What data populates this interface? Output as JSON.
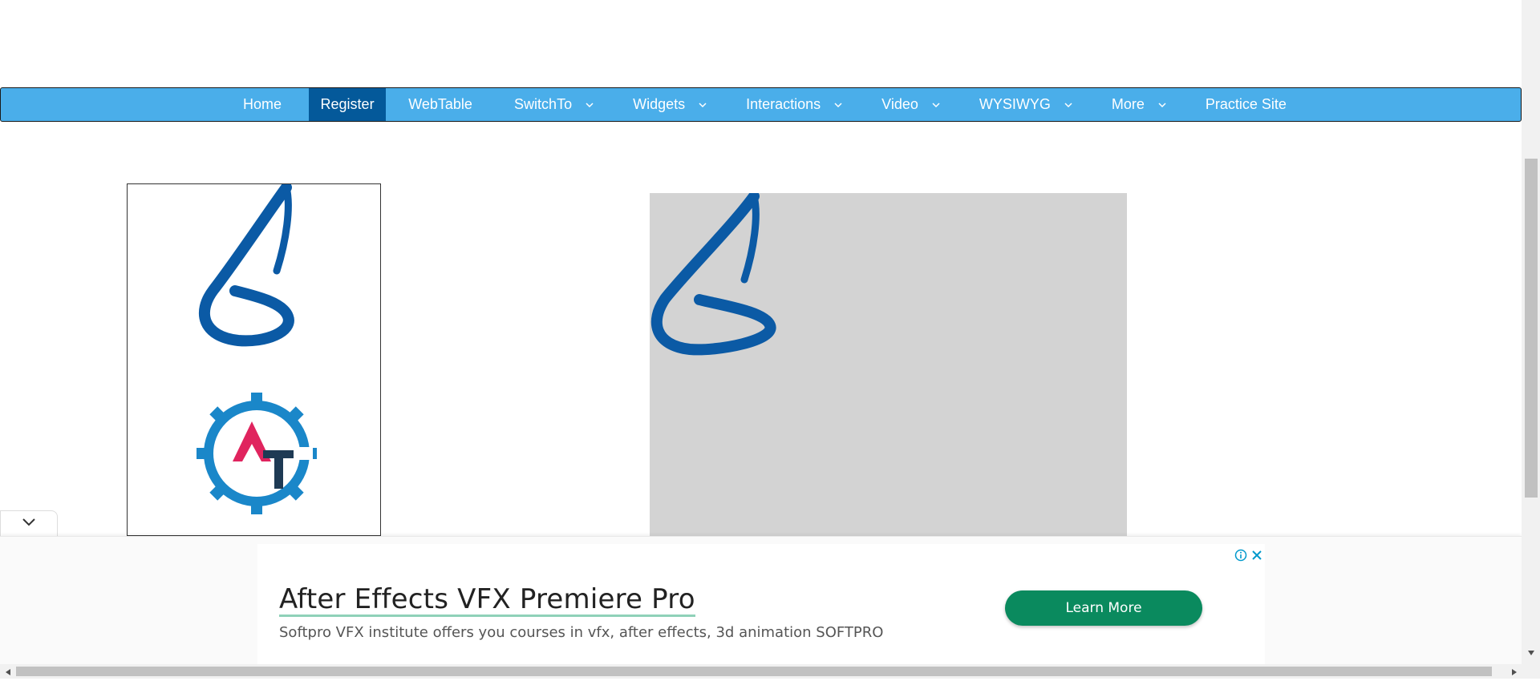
{
  "nav": {
    "items": [
      {
        "label": "Home",
        "dropdown": false,
        "active": false
      },
      {
        "label": "Register",
        "dropdown": false,
        "active": true
      },
      {
        "label": "WebTable",
        "dropdown": false,
        "active": false
      },
      {
        "label": "SwitchTo",
        "dropdown": true,
        "active": false
      },
      {
        "label": "Widgets",
        "dropdown": true,
        "active": false
      },
      {
        "label": "Interactions",
        "dropdown": true,
        "active": false
      },
      {
        "label": "Video",
        "dropdown": true,
        "active": false
      },
      {
        "label": "WYSIWYG",
        "dropdown": true,
        "active": false
      },
      {
        "label": "More",
        "dropdown": true,
        "active": false
      },
      {
        "label": "Practice Site",
        "dropdown": false,
        "active": false
      }
    ]
  },
  "drag_box": {
    "icons": [
      "selenium-s-logo",
      "automation-testing-gear-logo"
    ]
  },
  "drop_box": {
    "icons": [
      "selenium-s-logo"
    ]
  },
  "ad": {
    "title": "After Effects VFX Premiere Pro",
    "description": "Softpro VFX institute offers you courses in vfx, after effects, 3d animation SOFTPRO",
    "button_label": "Learn More",
    "icons": [
      "info-icon",
      "close-icon"
    ]
  },
  "colors": {
    "nav_bg": "#4aaeea",
    "nav_active": "#04599a",
    "drop_bg": "#d3d3d3",
    "logo_blue": "#0b5aa5",
    "logo_red": "#e0245e",
    "ad_button": "#0a8a5e"
  }
}
